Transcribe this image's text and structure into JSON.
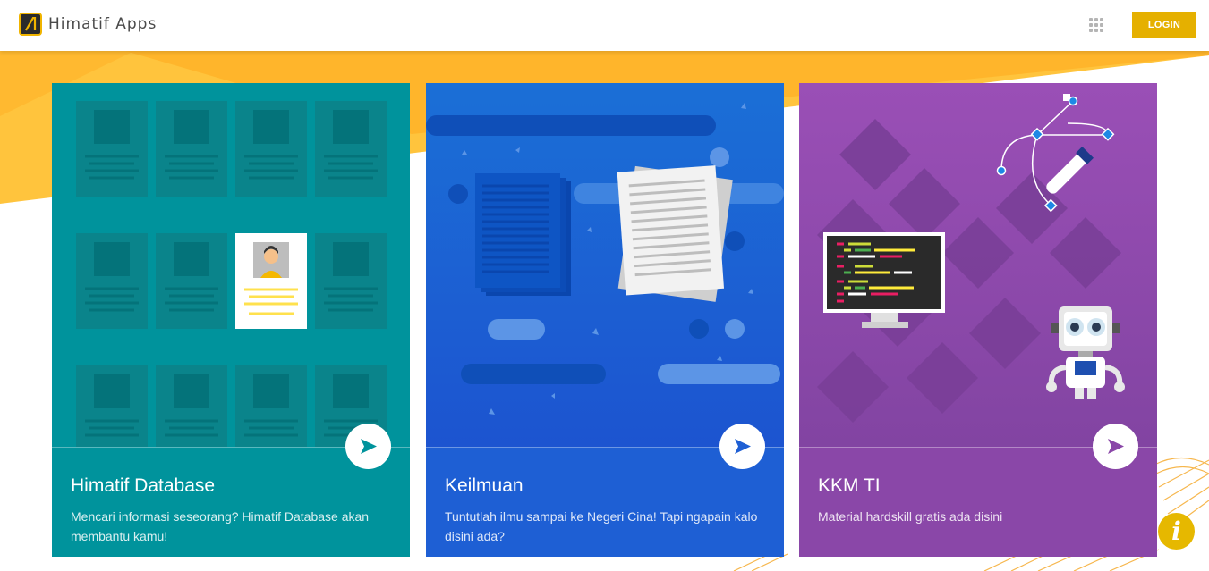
{
  "header": {
    "brand_name": "Himatif Apps",
    "login_label": "LOGIN"
  },
  "cards": [
    {
      "title": "Himatif Database",
      "description": "Mencari informasi seseorang? Himatif Database akan membantu kamu!",
      "color": "#00939c"
    },
    {
      "title": "Keilmuan",
      "description": "Tuntutlah ilmu sampai ke Negeri Cina! Tapi ngapain kalo disini ada?",
      "color": "#1e5fd4"
    },
    {
      "title": "KKM TI",
      "description": "Material hardskill gratis ada disini",
      "color": "#8a47a8"
    }
  ],
  "info_button": {
    "label": "i"
  },
  "colors": {
    "accent": "#e5b000",
    "teal": "#00939c",
    "blue": "#1e5fd4",
    "purple": "#8a47a8"
  }
}
